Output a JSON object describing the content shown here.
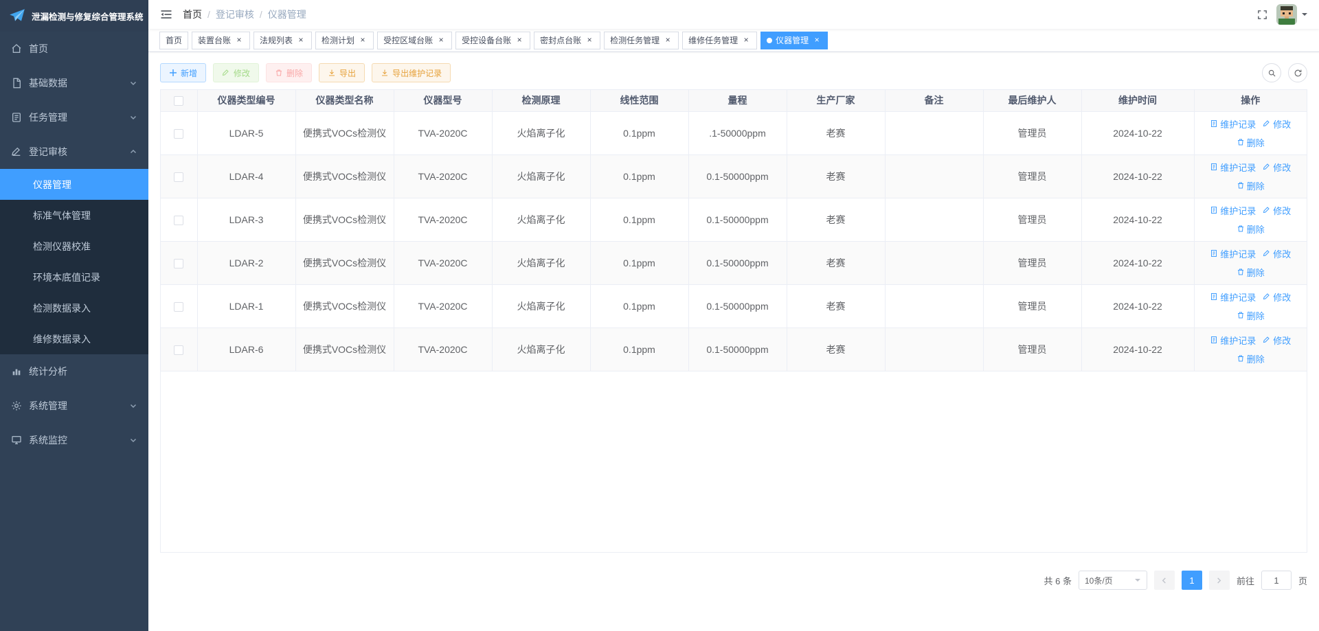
{
  "app": {
    "title": "泄漏检测与修复综合管理系统"
  },
  "colors": {
    "accent": "#409EFF",
    "sidebar_bg": "#304156",
    "submenu_bg": "#1f2d3d",
    "success": "#67c23a",
    "danger": "#f56c6c",
    "warning": "#e6a23c",
    "header_bg": "#f8f8f9"
  },
  "ui": {
    "close": "×"
  },
  "breadcrumb": {
    "separator": "/",
    "parts": [
      "首页",
      "登记审核",
      "仪器管理"
    ]
  },
  "sidebar": {
    "menu": [
      {
        "label": "首页"
      },
      {
        "label": "基础数据"
      },
      {
        "label": "任务管理"
      },
      {
        "label": "登记审核"
      },
      {
        "label": "统计分析"
      },
      {
        "label": "系统管理"
      },
      {
        "label": "系统监控"
      }
    ],
    "submenu": [
      {
        "label": "仪器管理"
      },
      {
        "label": "标准气体管理"
      },
      {
        "label": "检测仪器校准"
      },
      {
        "label": "环境本底值记录"
      },
      {
        "label": "检测数据录入"
      },
      {
        "label": "维修数据录入"
      }
    ]
  },
  "tags": [
    {
      "label": "首页"
    },
    {
      "label": "装置台账"
    },
    {
      "label": "法规列表"
    },
    {
      "label": "检测计划"
    },
    {
      "label": "受控区域台账"
    },
    {
      "label": "受控设备台账"
    },
    {
      "label": "密封点台账"
    },
    {
      "label": "检测任务管理"
    },
    {
      "label": "维修任务管理"
    },
    {
      "label": "仪器管理"
    }
  ],
  "toolbar": {
    "add": "新增",
    "edit": "修改",
    "delete": "删除",
    "export": "导出",
    "export_maintenance": "导出维护记录"
  },
  "table": {
    "headers": [
      "仪器类型编号",
      "仪器类型名称",
      "仪器型号",
      "检测原理",
      "线性范围",
      "量程",
      "生产厂家",
      "备注",
      "最后维护人",
      "维护时间",
      "操作"
    ],
    "ops": {
      "record": "维护记录",
      "edit": "修改",
      "delete": "删除"
    },
    "rows": [
      {
        "code": "LDAR-5",
        "name": "便携式VOCs检测仪",
        "model": "TVA-2020C",
        "principle": "火焰离子化",
        "linear": "0.1ppm",
        "range": ".1-50000ppm",
        "vendor": "老赛",
        "remark": "",
        "maintainer": "管理员",
        "time": "2024-10-22"
      },
      {
        "code": "LDAR-4",
        "name": "便携式VOCs检测仪",
        "model": "TVA-2020C",
        "principle": "火焰离子化",
        "linear": "0.1ppm",
        "range": "0.1-50000ppm",
        "vendor": "老赛",
        "remark": "",
        "maintainer": "管理员",
        "time": "2024-10-22"
      },
      {
        "code": "LDAR-3",
        "name": "便携式VOCs检测仪",
        "model": "TVA-2020C",
        "principle": "火焰离子化",
        "linear": "0.1ppm",
        "range": "0.1-50000ppm",
        "vendor": "老赛",
        "remark": "",
        "maintainer": "管理员",
        "time": "2024-10-22"
      },
      {
        "code": "LDAR-2",
        "name": "便携式VOCs检测仪",
        "model": "TVA-2020C",
        "principle": "火焰离子化",
        "linear": "0.1ppm",
        "range": "0.1-50000ppm",
        "vendor": "老赛",
        "remark": "",
        "maintainer": "管理员",
        "time": "2024-10-22"
      },
      {
        "code": "LDAR-1",
        "name": "便携式VOCs检测仪",
        "model": "TVA-2020C",
        "principle": "火焰离子化",
        "linear": "0.1ppm",
        "range": "0.1-50000ppm",
        "vendor": "老赛",
        "remark": "",
        "maintainer": "管理员",
        "time": "2024-10-22"
      },
      {
        "code": "LDAR-6",
        "name": "便携式VOCs检测仪",
        "model": "TVA-2020C",
        "principle": "火焰离子化",
        "linear": "0.1ppm",
        "range": "0.1-50000ppm",
        "vendor": "老赛",
        "remark": "",
        "maintainer": "管理员",
        "time": "2024-10-22"
      }
    ]
  },
  "pagination": {
    "total": "共 6 条",
    "page_size": "10条/页",
    "page": "1",
    "goto_label": "前往",
    "goto_value": "1",
    "unit": "页"
  }
}
